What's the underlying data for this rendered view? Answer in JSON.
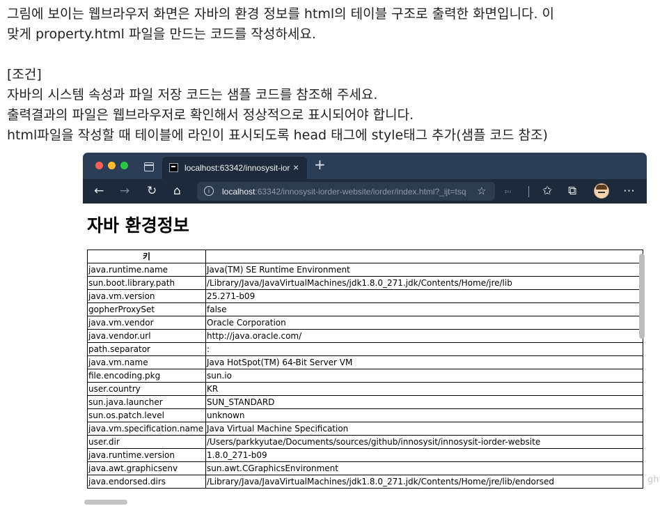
{
  "instructions": {
    "lines": [
      "그림에 보이는 웹브라우저 화면은 자바의 환경 정보를 html의 테이블 구조로 출력한 화면입니다. 이",
      "맞게 property.html 파일을 만드는 코드를 작성하세요.",
      "",
      "[조건]",
      "자바의 시스템 속성과 파일 저장 코드는 샘플 코드를 참조해 주세요.",
      "출력결과의 파일은 웹브라우저로 확인해서 정상적으로 표시되어야 합니다.",
      "html파일을 작성할 때 테이블에 라인이 표시되도록 head 태그에 style태그 추가(샘플 코드 참조)"
    ]
  },
  "browser": {
    "tab": {
      "title": "localhost:63342/innosysit-iord",
      "close": "×"
    },
    "new_tab": "+",
    "address": {
      "host": "localhost",
      "rest": ":63342/innosysit-iorder-website/iorder/index.html?_ijt=tsqn..."
    },
    "toolbar_icons": {
      "back": "←",
      "forward": "→",
      "reload": "↻",
      "home": "⌂",
      "favorite": "☆",
      "ext": "ᵖᵘ",
      "favorites": "✩",
      "collections": "⧉",
      "more": "⋯"
    }
  },
  "page": {
    "title": "자바 환경정보",
    "table": {
      "headers": [
        "키",
        ""
      ],
      "rows": [
        [
          "java.runtime.name",
          "Java(TM) SE Runtime Environment"
        ],
        [
          "sun.boot.library.path",
          "/Library/Java/JavaVirtualMachines/jdk1.8.0_271.jdk/Contents/Home/jre/lib"
        ],
        [
          "java.vm.version",
          "25.271-b09"
        ],
        [
          "gopherProxySet",
          "false"
        ],
        [
          "java.vm.vendor",
          "Oracle Corporation"
        ],
        [
          "java.vendor.url",
          "http://java.oracle.com/"
        ],
        [
          "path.separator",
          ":"
        ],
        [
          "java.vm.name",
          "Java HotSpot(TM) 64-Bit Server VM"
        ],
        [
          "file.encoding.pkg",
          "sun.io"
        ],
        [
          "user.country",
          "KR"
        ],
        [
          "sun.java.launcher",
          "SUN_STANDARD"
        ],
        [
          "sun.os.patch.level",
          "unknown"
        ],
        [
          "java.vm.specification.name",
          "Java Virtual Machine Specification"
        ],
        [
          "user.dir",
          "/Users/parkkyutae/Documents/sources/github/innosysit/innosysit-iorder-website"
        ],
        [
          "java.runtime.version",
          "1.8.0_271-b09"
        ],
        [
          "java.awt.graphicsenv",
          "sun.awt.CGraphicsEnvironment"
        ],
        [
          "java.endorsed.dirs",
          "/Library/Java/JavaVirtualMachines/jdk1.8.0_271.jdk/Contents/Home/jre/lib/endorsed"
        ]
      ]
    }
  },
  "stray_text": "ght"
}
